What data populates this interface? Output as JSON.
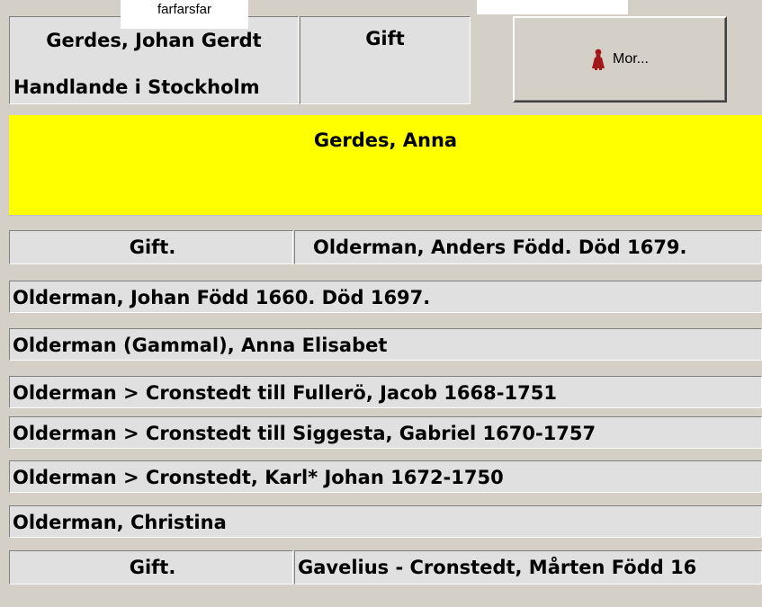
{
  "tooltip_left": "farfarsfar",
  "father": {
    "name": "Gerdes, Johan Gerdt",
    "title": "Handlande i Stockholm"
  },
  "marriage_status": "Gift",
  "mother_button_label": "Mor...",
  "mother_icon": "female-figure-icon",
  "selected_person": "Gerdes, Anna",
  "spouse_rows": [
    {
      "relation": "Gift.",
      "name": "Olderman, Anders Född. Död 1679."
    },
    {
      "relation": "Gift.",
      "name": "Gavelius - Cronstedt, Mårten Född 16"
    }
  ],
  "children": [
    "Olderman, Johan Född 1660. Död 1697.",
    "Olderman (Gammal), Anna Elisabet",
    "Olderman > Cronstedt till Fullerö, Jacob 1668-1751",
    "Olderman > Cronstedt till Siggesta, Gabriel 1670-1757",
    "Olderman > Cronstedt, Karl* Johan 1672-1750",
    "Olderman, Christina"
  ],
  "colors": {
    "highlight": "#ffff00",
    "cell": "#e0e0e0",
    "background": "#d4d0c8",
    "icon": "#a01818"
  }
}
